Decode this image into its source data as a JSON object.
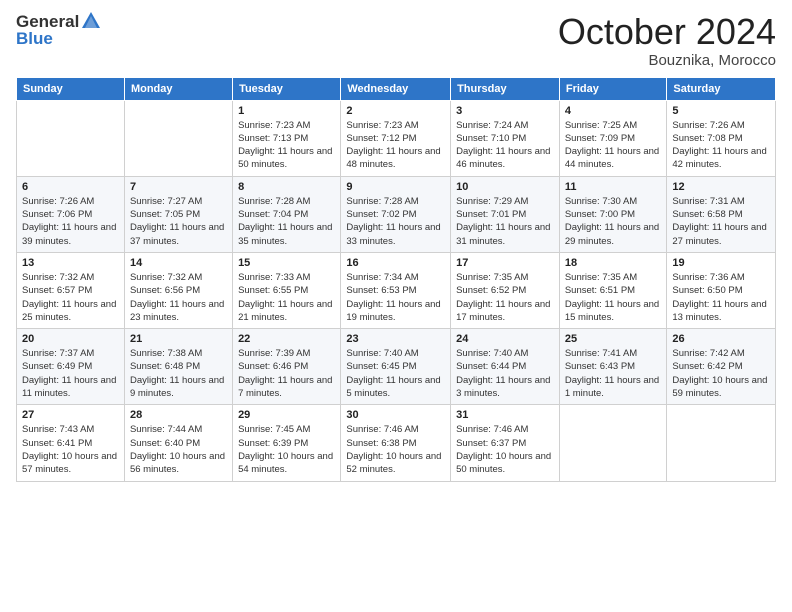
{
  "header": {
    "logo_general": "General",
    "logo_blue": "Blue",
    "month_title": "October 2024",
    "location": "Bouznika, Morocco"
  },
  "weekdays": [
    "Sunday",
    "Monday",
    "Tuesday",
    "Wednesday",
    "Thursday",
    "Friday",
    "Saturday"
  ],
  "weeks": [
    [
      {
        "day": "",
        "info": ""
      },
      {
        "day": "",
        "info": ""
      },
      {
        "day": "1",
        "info": "Sunrise: 7:23 AM\nSunset: 7:13 PM\nDaylight: 11 hours and 50 minutes."
      },
      {
        "day": "2",
        "info": "Sunrise: 7:23 AM\nSunset: 7:12 PM\nDaylight: 11 hours and 48 minutes."
      },
      {
        "day": "3",
        "info": "Sunrise: 7:24 AM\nSunset: 7:10 PM\nDaylight: 11 hours and 46 minutes."
      },
      {
        "day": "4",
        "info": "Sunrise: 7:25 AM\nSunset: 7:09 PM\nDaylight: 11 hours and 44 minutes."
      },
      {
        "day": "5",
        "info": "Sunrise: 7:26 AM\nSunset: 7:08 PM\nDaylight: 11 hours and 42 minutes."
      }
    ],
    [
      {
        "day": "6",
        "info": "Sunrise: 7:26 AM\nSunset: 7:06 PM\nDaylight: 11 hours and 39 minutes."
      },
      {
        "day": "7",
        "info": "Sunrise: 7:27 AM\nSunset: 7:05 PM\nDaylight: 11 hours and 37 minutes."
      },
      {
        "day": "8",
        "info": "Sunrise: 7:28 AM\nSunset: 7:04 PM\nDaylight: 11 hours and 35 minutes."
      },
      {
        "day": "9",
        "info": "Sunrise: 7:28 AM\nSunset: 7:02 PM\nDaylight: 11 hours and 33 minutes."
      },
      {
        "day": "10",
        "info": "Sunrise: 7:29 AM\nSunset: 7:01 PM\nDaylight: 11 hours and 31 minutes."
      },
      {
        "day": "11",
        "info": "Sunrise: 7:30 AM\nSunset: 7:00 PM\nDaylight: 11 hours and 29 minutes."
      },
      {
        "day": "12",
        "info": "Sunrise: 7:31 AM\nSunset: 6:58 PM\nDaylight: 11 hours and 27 minutes."
      }
    ],
    [
      {
        "day": "13",
        "info": "Sunrise: 7:32 AM\nSunset: 6:57 PM\nDaylight: 11 hours and 25 minutes."
      },
      {
        "day": "14",
        "info": "Sunrise: 7:32 AM\nSunset: 6:56 PM\nDaylight: 11 hours and 23 minutes."
      },
      {
        "day": "15",
        "info": "Sunrise: 7:33 AM\nSunset: 6:55 PM\nDaylight: 11 hours and 21 minutes."
      },
      {
        "day": "16",
        "info": "Sunrise: 7:34 AM\nSunset: 6:53 PM\nDaylight: 11 hours and 19 minutes."
      },
      {
        "day": "17",
        "info": "Sunrise: 7:35 AM\nSunset: 6:52 PM\nDaylight: 11 hours and 17 minutes."
      },
      {
        "day": "18",
        "info": "Sunrise: 7:35 AM\nSunset: 6:51 PM\nDaylight: 11 hours and 15 minutes."
      },
      {
        "day": "19",
        "info": "Sunrise: 7:36 AM\nSunset: 6:50 PM\nDaylight: 11 hours and 13 minutes."
      }
    ],
    [
      {
        "day": "20",
        "info": "Sunrise: 7:37 AM\nSunset: 6:49 PM\nDaylight: 11 hours and 11 minutes."
      },
      {
        "day": "21",
        "info": "Sunrise: 7:38 AM\nSunset: 6:48 PM\nDaylight: 11 hours and 9 minutes."
      },
      {
        "day": "22",
        "info": "Sunrise: 7:39 AM\nSunset: 6:46 PM\nDaylight: 11 hours and 7 minutes."
      },
      {
        "day": "23",
        "info": "Sunrise: 7:40 AM\nSunset: 6:45 PM\nDaylight: 11 hours and 5 minutes."
      },
      {
        "day": "24",
        "info": "Sunrise: 7:40 AM\nSunset: 6:44 PM\nDaylight: 11 hours and 3 minutes."
      },
      {
        "day": "25",
        "info": "Sunrise: 7:41 AM\nSunset: 6:43 PM\nDaylight: 11 hours and 1 minute."
      },
      {
        "day": "26",
        "info": "Sunrise: 7:42 AM\nSunset: 6:42 PM\nDaylight: 10 hours and 59 minutes."
      }
    ],
    [
      {
        "day": "27",
        "info": "Sunrise: 7:43 AM\nSunset: 6:41 PM\nDaylight: 10 hours and 57 minutes."
      },
      {
        "day": "28",
        "info": "Sunrise: 7:44 AM\nSunset: 6:40 PM\nDaylight: 10 hours and 56 minutes."
      },
      {
        "day": "29",
        "info": "Sunrise: 7:45 AM\nSunset: 6:39 PM\nDaylight: 10 hours and 54 minutes."
      },
      {
        "day": "30",
        "info": "Sunrise: 7:46 AM\nSunset: 6:38 PM\nDaylight: 10 hours and 52 minutes."
      },
      {
        "day": "31",
        "info": "Sunrise: 7:46 AM\nSunset: 6:37 PM\nDaylight: 10 hours and 50 minutes."
      },
      {
        "day": "",
        "info": ""
      },
      {
        "day": "",
        "info": ""
      }
    ]
  ]
}
